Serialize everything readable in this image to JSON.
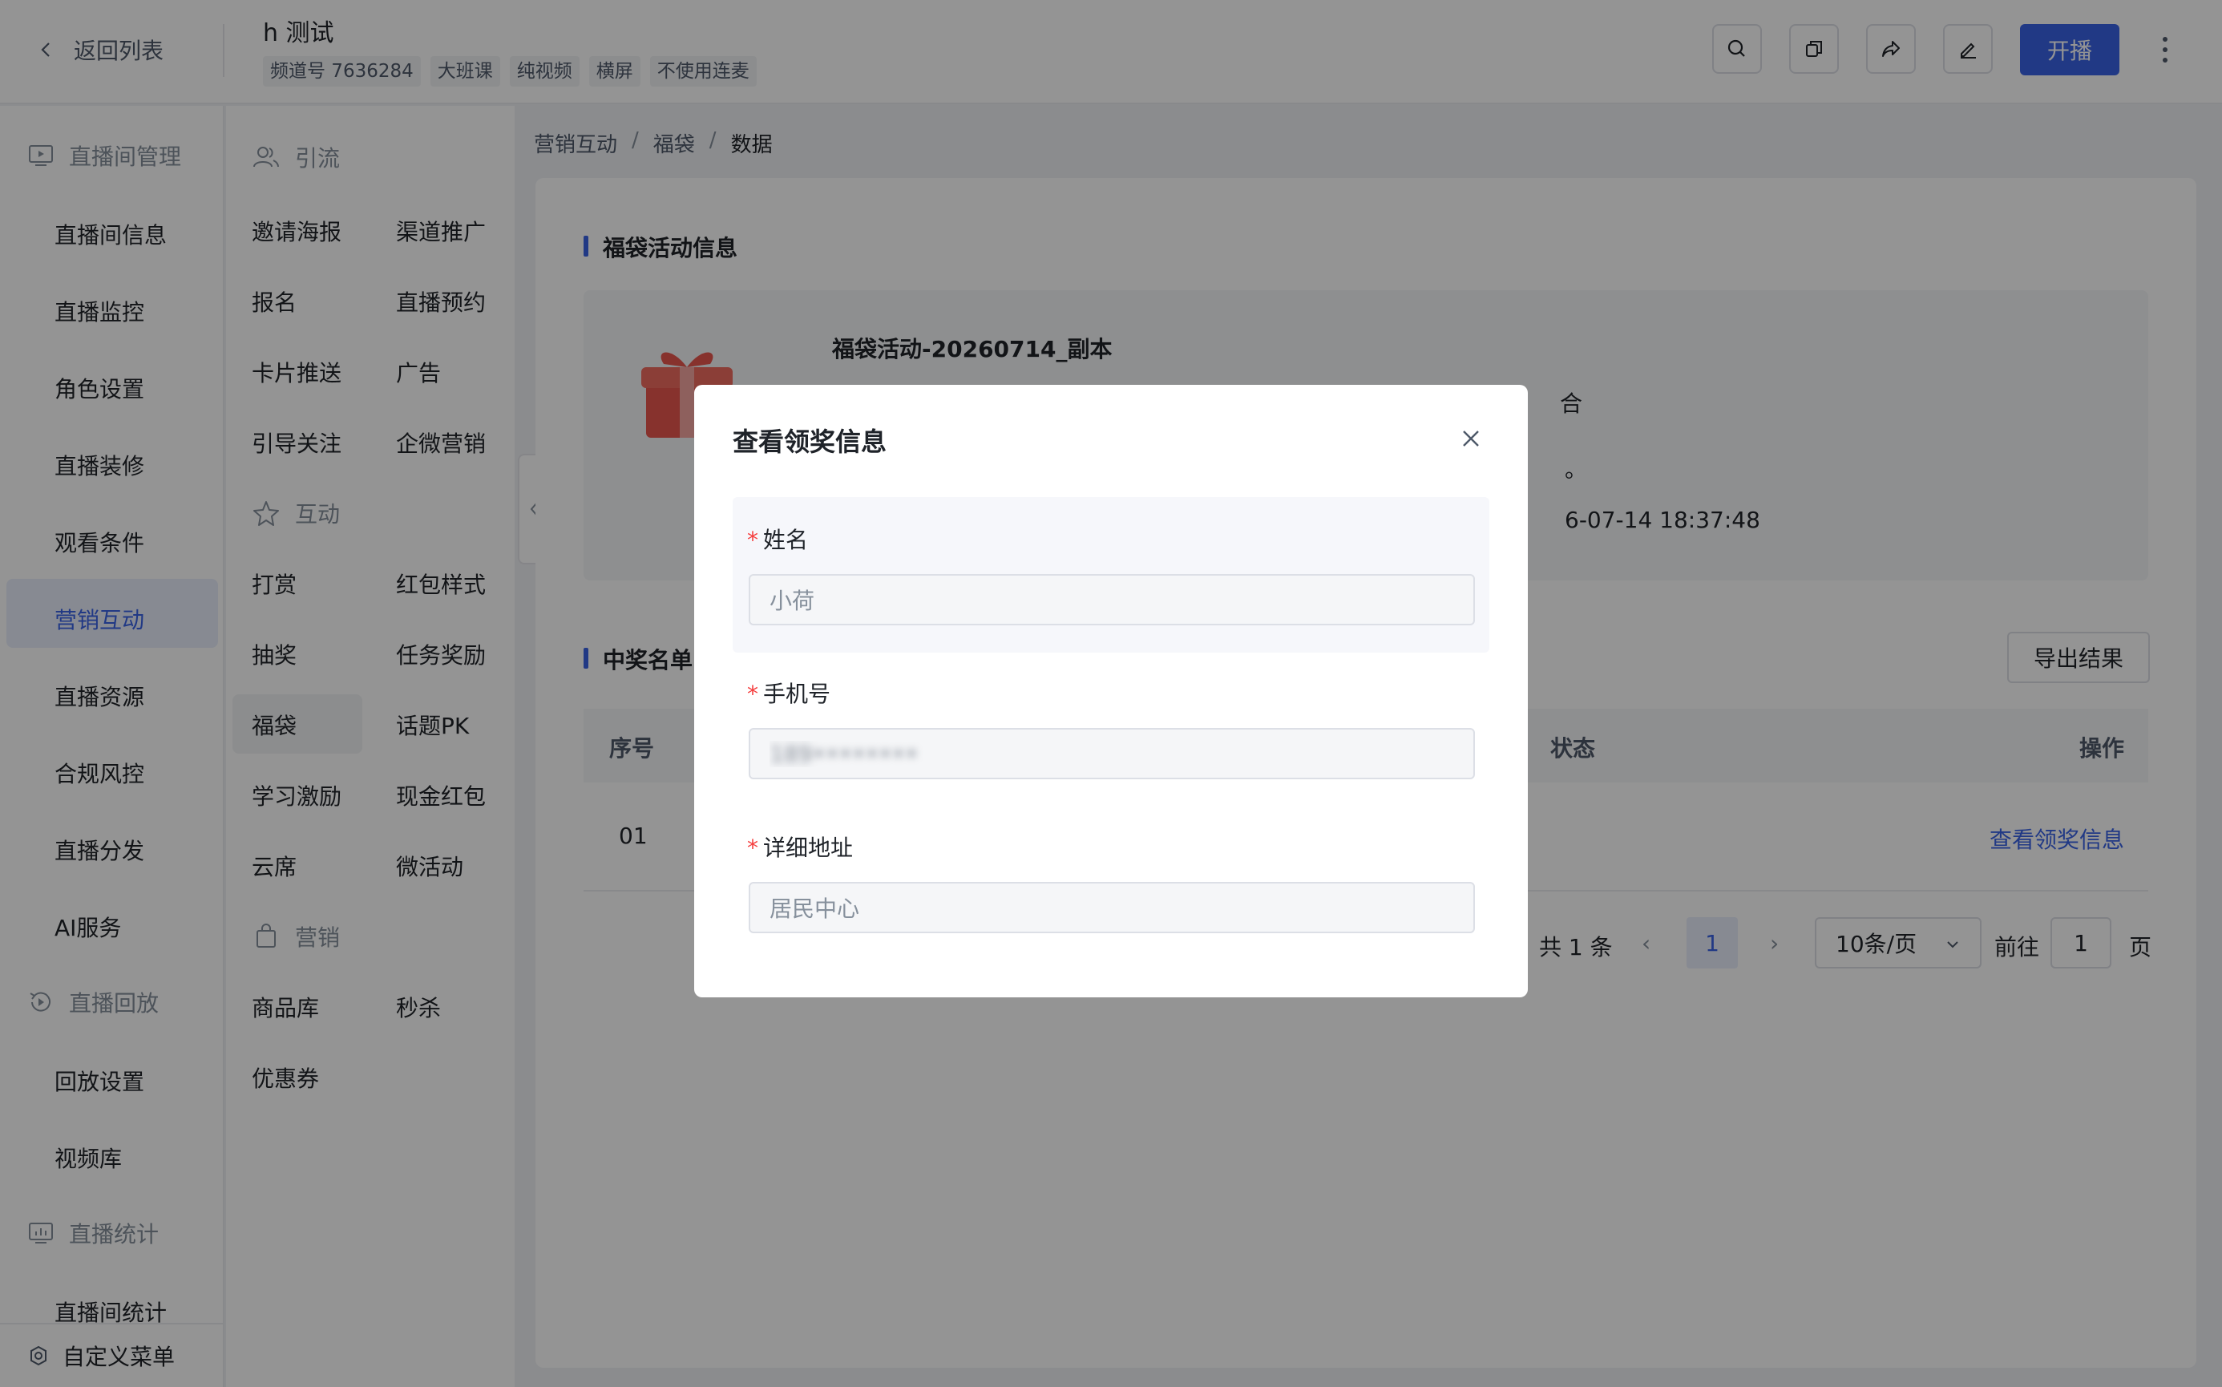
{
  "header": {
    "back_label": "返回列表",
    "room_title": "h 测试",
    "tags": [
      "频道号 7636284",
      "大班课",
      "纯视频",
      "横屏",
      "不使用连麦"
    ],
    "start_label": "开播"
  },
  "sidebar": {
    "groups": {
      "live_manage": "直播间管理",
      "replay": "直播回放",
      "stats": "直播统计"
    },
    "items": {
      "room_info": "直播间信息",
      "monitor": "直播监控",
      "roles": "角色设置",
      "decor": "直播装修",
      "watch": "观看条件",
      "marketing": "营销互动",
      "resources": "直播资源",
      "compliance": "合规风控",
      "distribution": "直播分发",
      "ai": "AI服务",
      "replay_settings": "回放设置",
      "video_lib": "视频库",
      "room_stats": "直播间统计"
    },
    "custom_menu": "自定义菜单"
  },
  "submenu": {
    "groups": {
      "traffic": "引流",
      "interact": "互动",
      "marketing": "营销"
    },
    "traffic": [
      "邀请海报",
      "渠道推广",
      "报名",
      "直播预约",
      "卡片推送",
      "广告",
      "引导关注",
      "企微营销"
    ],
    "interact": [
      "打赏",
      "红包样式",
      "抽奖",
      "任务奖励",
      "福袋",
      "话题PK",
      "学习激励",
      "现金红包",
      "云席",
      "微活动"
    ],
    "marketing": [
      "商品库",
      "秒杀",
      "优惠券"
    ]
  },
  "breadcrumb": {
    "a": "营销互动",
    "b": "福袋",
    "c": "数据",
    "sep": "/"
  },
  "activity": {
    "section_title": "福袋活动信息",
    "name": "福袋活动-20260714_副本",
    "meta1": "合",
    "meta2": "。",
    "meta3": "6-07-14 18:37:48"
  },
  "winners": {
    "section_title": "中奖名单",
    "export_label": "导出结果",
    "columns": {
      "index": "序号",
      "status": "状态",
      "action": "操作"
    },
    "rows": [
      {
        "index": "01",
        "status": "",
        "action": "查看领奖信息"
      }
    ]
  },
  "pagination": {
    "total": "共 1 条",
    "prev": "‹",
    "next": "›",
    "current": "1",
    "page_size": "10条/页",
    "goto_label": "前往",
    "goto_value": "1",
    "page_word": "页"
  },
  "modal": {
    "title": "查看领奖信息",
    "required_mark": "*",
    "fields": {
      "name": {
        "label": "姓名",
        "value": "小荷"
      },
      "phone": {
        "label": "手机号",
        "value": "189••••••••"
      },
      "address": {
        "label": "详细地址",
        "value": "居民中心"
      }
    }
  },
  "colors": {
    "accent": "#3a63e6",
    "required": "#f53f3f"
  },
  "icons": [
    "chevron-left-icon",
    "search-icon",
    "copy-icon",
    "share-icon",
    "edit-icon",
    "more-vertical-icon",
    "live-screen-icon",
    "users-icon",
    "star-icon",
    "bag-icon",
    "replay-icon",
    "stats-icon",
    "settings-icon",
    "gift-icon",
    "close-icon",
    "chevron-down-icon"
  ]
}
